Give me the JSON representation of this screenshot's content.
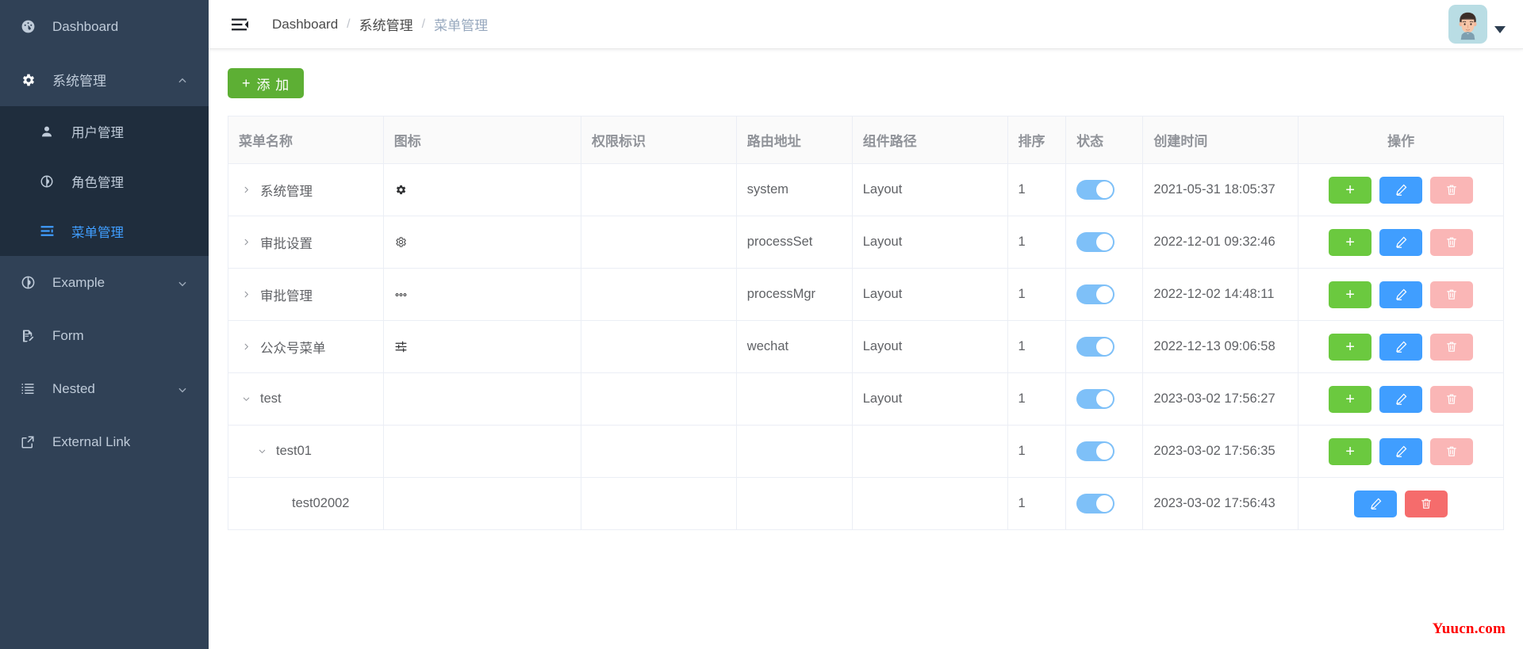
{
  "sidebar": {
    "items": [
      {
        "label": "Dashboard",
        "icon": "dashboard-icon",
        "has_arrow": false,
        "level": 0
      },
      {
        "label": "系统管理",
        "icon": "gear-icon",
        "has_arrow": true,
        "arrow": "up",
        "level": 0,
        "expanded": true
      },
      {
        "label": "用户管理",
        "icon": "user-icon",
        "level": 1,
        "active": false
      },
      {
        "label": "角色管理",
        "icon": "role-circle-icon",
        "level": 1,
        "active": false
      },
      {
        "label": "菜单管理",
        "icon": "menu-list-icon",
        "level": 1,
        "active": true
      },
      {
        "label": "Example",
        "icon": "example-circle-icon",
        "has_arrow": true,
        "arrow": "down",
        "level": 0
      },
      {
        "label": "Form",
        "icon": "form-icon",
        "has_arrow": false,
        "level": 0
      },
      {
        "label": "Nested",
        "icon": "nested-list-icon",
        "has_arrow": true,
        "arrow": "down",
        "level": 0
      },
      {
        "label": "External Link",
        "icon": "external-link-icon",
        "has_arrow": false,
        "level": 0
      }
    ]
  },
  "navbar": {
    "hamburger_icon": "hamburger-collapse-icon",
    "breadcrumb": [
      {
        "label": "Dashboard",
        "active": false
      },
      {
        "label": "系统管理",
        "active": false
      },
      {
        "label": "菜单管理",
        "active": true
      }
    ],
    "separator": "/",
    "avatar_icon": "user-avatar",
    "caret_icon": "caret-down-icon"
  },
  "toolbar": {
    "add_label": "添 加",
    "add_plus": "+"
  },
  "table": {
    "columns": [
      "菜单名称",
      "图标",
      "权限标识",
      "路由地址",
      "组件路径",
      "排序",
      "状态",
      "创建时间",
      "操作"
    ],
    "rows": [
      {
        "name": "系统管理",
        "indent": 0,
        "caret": "right",
        "icon": "gear-solid-icon",
        "perm": "",
        "route": "system",
        "component": "Layout",
        "sort": "1",
        "status_on": true,
        "created": "2021-05-31 18:05:37",
        "actions": [
          "add",
          "edit",
          "delete-light"
        ]
      },
      {
        "name": "审批设置",
        "indent": 0,
        "caret": "right",
        "icon": "gear-outline-icon",
        "perm": "",
        "route": "processSet",
        "component": "Layout",
        "sort": "1",
        "status_on": true,
        "created": "2022-12-01 09:32:46",
        "actions": [
          "add",
          "edit",
          "delete-light"
        ]
      },
      {
        "name": "审批管理",
        "indent": 0,
        "caret": "right",
        "icon": "more-dots-icon",
        "perm": "",
        "route": "processMgr",
        "component": "Layout",
        "sort": "1",
        "status_on": true,
        "created": "2022-12-02 14:48:11",
        "actions": [
          "add",
          "edit",
          "delete-light"
        ]
      },
      {
        "name": "公众号菜单",
        "indent": 0,
        "caret": "right",
        "icon": "sliders-icon",
        "perm": "",
        "route": "wechat",
        "component": "Layout",
        "sort": "1",
        "status_on": true,
        "created": "2022-12-13 09:06:58",
        "actions": [
          "add",
          "edit",
          "delete-light"
        ]
      },
      {
        "name": "test",
        "indent": 0,
        "caret": "down",
        "icon": "",
        "perm": "",
        "route": "",
        "component": "Layout",
        "sort": "1",
        "status_on": true,
        "created": "2023-03-02 17:56:27",
        "actions": [
          "add",
          "edit",
          "delete-light"
        ]
      },
      {
        "name": "test01",
        "indent": 1,
        "caret": "down",
        "icon": "",
        "perm": "",
        "route": "",
        "component": "",
        "sort": "1",
        "status_on": true,
        "created": "2023-03-02 17:56:35",
        "actions": [
          "add",
          "edit",
          "delete-light"
        ]
      },
      {
        "name": "test02002",
        "indent": 2,
        "caret": "none",
        "icon": "",
        "perm": "",
        "route": "",
        "component": "",
        "sort": "1",
        "status_on": true,
        "created": "2023-03-02 17:56:43",
        "actions": [
          "edit",
          "delete"
        ]
      }
    ]
  },
  "watermark": {
    "text": "Yuucn.com"
  },
  "colors": {
    "sidebar_bg": "#304156",
    "submenu_bg": "#1f2d3d",
    "accent_blue": "#409eff",
    "add_green": "#5daf34",
    "btn_add_green": "#6bc93f",
    "delete_red": "#f56c6c",
    "delete_red_light": "#fab6b6",
    "switch_on": "#7ec0f8",
    "watermark_red": "#ff0000"
  }
}
